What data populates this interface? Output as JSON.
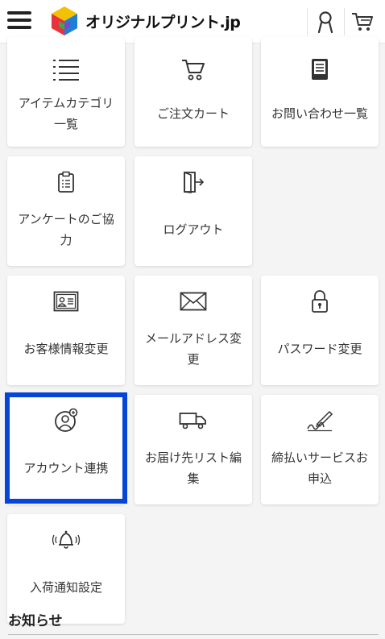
{
  "header": {
    "logo_text": "オリジナルプリント.jp",
    "menu_icon": "hamburger-icon",
    "account_icon": "user-icon",
    "cart_icon": "cart-icon"
  },
  "colors": {
    "highlight": "#0645d8",
    "background": "#f4f4f4",
    "tile": "#ffffff"
  },
  "menu": {
    "tiles": [
      {
        "icon": "list-icon",
        "label": "アイテムカテゴリ一覧"
      },
      {
        "icon": "cart-icon",
        "label": "ご注文カート"
      },
      {
        "icon": "document-icon",
        "label": "お問い合わせ一覧"
      },
      {
        "icon": "clipboard-icon",
        "label": "アンケートのご協力"
      },
      {
        "icon": "logout-icon",
        "label": "ログアウト"
      },
      {
        "icon": "id-card-icon",
        "label": "お客様情報変更"
      },
      {
        "icon": "envelope-icon",
        "label": "メールアドレス変更"
      },
      {
        "icon": "lock-icon",
        "label": "パスワード変更"
      },
      {
        "icon": "account-link-icon",
        "label": "アカウント連携"
      },
      {
        "icon": "truck-icon",
        "label": "お届け先リスト編集"
      },
      {
        "icon": "signature-icon",
        "label": "締払いサービスお申込"
      },
      {
        "icon": "bell-icon",
        "label": "入荷通知設定"
      }
    ]
  },
  "notices": {
    "title": "お知らせ"
  }
}
